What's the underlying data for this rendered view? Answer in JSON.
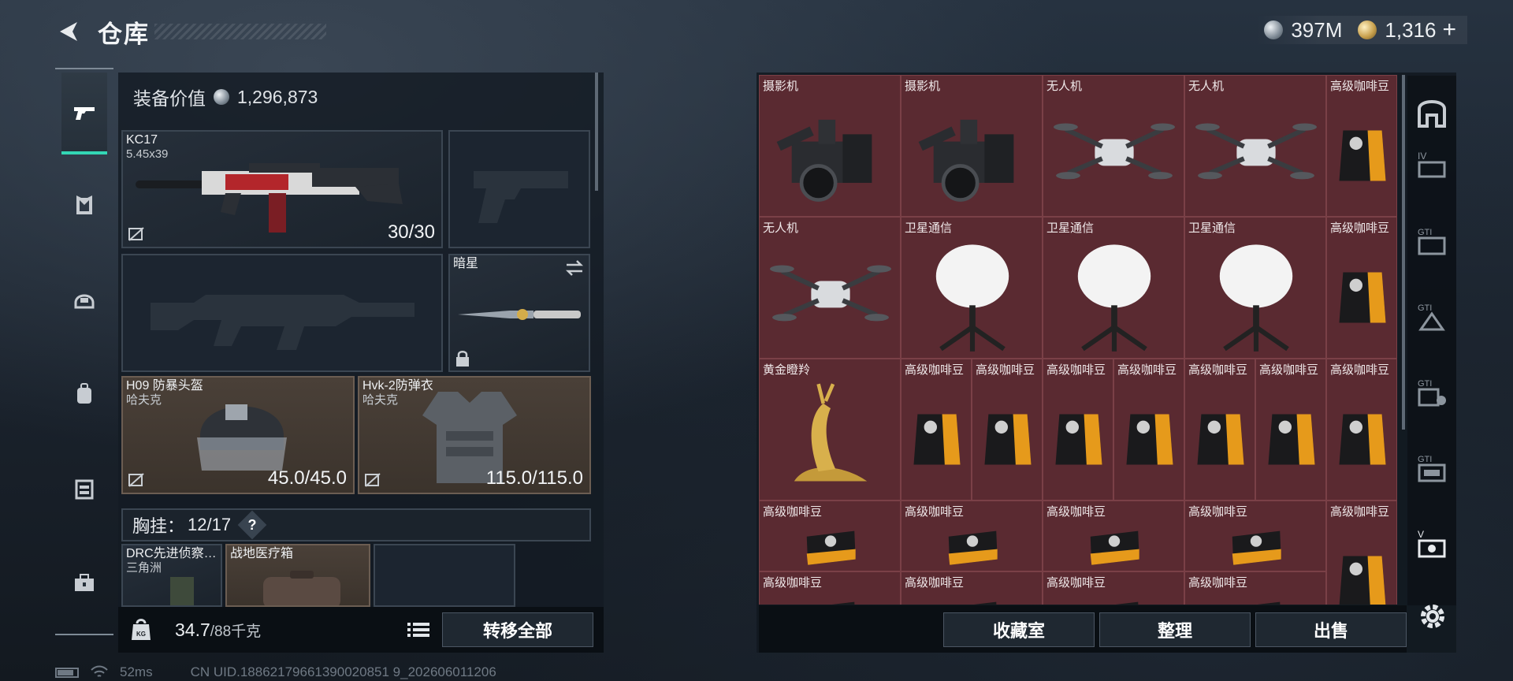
{
  "header": {
    "title": "仓库",
    "currency_silver": "397M",
    "currency_gold": "1,316",
    "plus_label": "+"
  },
  "left_nav": {
    "items": [
      "pistol-icon",
      "armor-icon",
      "helmet-icon",
      "backpack-icon",
      "vest-icon",
      "toolbox-icon"
    ],
    "active_index": 0
  },
  "equipment": {
    "value_label": "装备价值",
    "value": "1,296,873",
    "primary": {
      "name": "KC17",
      "ammo_type": "5.45x39",
      "ammo": "30/30"
    },
    "melee": {
      "name": "暗星"
    },
    "helmet": {
      "name": "H09 防暴头盔",
      "brand": "哈夫克",
      "durability": "45.0/45.0"
    },
    "armor": {
      "name": "Hvk-2防弹衣",
      "brand": "哈夫克",
      "durability": "115.0/115.0"
    },
    "vest_label": "胸挂：",
    "vest_capacity": "12/17",
    "help_label": "?",
    "vest_items": [
      {
        "name": "DRC先进侦察…",
        "brand": "三角洲"
      },
      {
        "name": "战地医疗箱"
      }
    ]
  },
  "weight": {
    "current": "34.7",
    "max_label": "/88千克",
    "transfer_all": "转移全部"
  },
  "status": {
    "ping": "52ms",
    "uid": "CN UID.18862179661390020851 9_202606011206"
  },
  "stash": {
    "cells": [
      {
        "label": "摄影机",
        "icon": "camera"
      },
      {
        "label": "摄影机",
        "icon": "camera"
      },
      {
        "label": "无人机",
        "icon": "drone"
      },
      {
        "label": "无人机",
        "icon": "drone"
      },
      {
        "label": "高级咖啡豆",
        "icon": "coffee"
      },
      {
        "label": "无人机",
        "icon": "drone"
      },
      {
        "label": "卫星通信",
        "icon": "satellite"
      },
      {
        "label": "卫星通信",
        "icon": "satellite"
      },
      {
        "label": "卫星通信",
        "icon": "satellite"
      },
      {
        "label": "高级咖啡豆",
        "icon": "coffee"
      },
      {
        "label": "黄金瞪羚",
        "icon": "gazelle"
      },
      {
        "label": "高级咖啡豆",
        "icon": "coffee"
      },
      {
        "label": "高级咖啡豆",
        "icon": "coffee"
      },
      {
        "label": "高级咖啡豆",
        "icon": "coffee"
      },
      {
        "label": "高级咖啡豆",
        "icon": "coffee"
      },
      {
        "label": "高级咖啡豆",
        "icon": "coffee"
      },
      {
        "label": "高级咖啡豆",
        "icon": "coffee"
      },
      {
        "label": "高级咖啡豆",
        "icon": "coffee"
      },
      {
        "label": "高级咖啡豆",
        "icon": "coffee-flat"
      },
      {
        "label": "高级咖啡豆",
        "icon": "coffee-flat"
      },
      {
        "label": "高级咖啡豆",
        "icon": "coffee-flat"
      },
      {
        "label": "高级咖啡豆",
        "icon": "coffee-flat"
      },
      {
        "label": "高级咖啡豆",
        "icon": "coffee"
      },
      {
        "label": "高级咖啡豆",
        "icon": "coffee-flat"
      },
      {
        "label": "高级咖啡豆",
        "icon": "coffee-flat"
      },
      {
        "label": "高级咖啡豆",
        "icon": "coffee-flat"
      },
      {
        "label": "高级咖啡豆",
        "icon": "coffee-flat"
      }
    ],
    "buttons": {
      "collection": "收藏室",
      "sort": "整理",
      "sell": "出售"
    }
  },
  "right_nav": {
    "items": [
      "stash-arch-icon",
      "container-iv-icon",
      "container-gti-1-icon",
      "container-gti-2-icon",
      "container-gti-3-icon",
      "container-gti-4-icon",
      "container-v-icon"
    ]
  },
  "colors": {
    "accent": "#33d6b5",
    "cell_bg": "#5a2a31",
    "slot_brown": "#4a4038"
  }
}
